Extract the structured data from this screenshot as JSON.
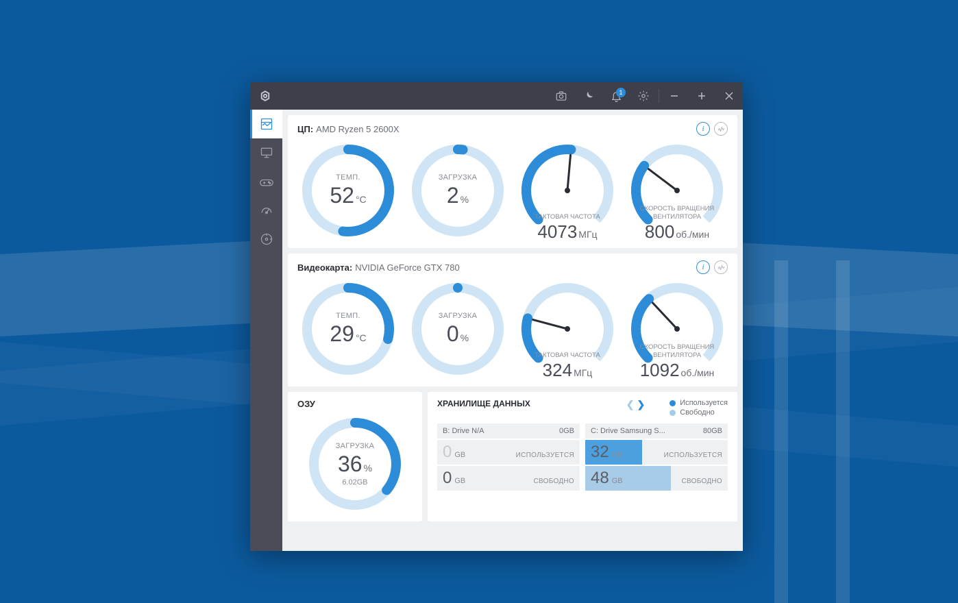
{
  "titlebar": {
    "badge": "1"
  },
  "cpu": {
    "label": "ЦП:",
    "name": "AMD Ryzen 5 2600X",
    "temp": {
      "label": "ТЕМП.",
      "value": "52",
      "unit": "°C",
      "pct": 52
    },
    "load": {
      "label": "ЗАГРУЗКА",
      "value": "2",
      "unit": "%",
      "pct": 2
    },
    "clock": {
      "label": "ТАКТОВАЯ ЧАСТОТА",
      "value": "4073",
      "unit": "МГц",
      "deg": 140
    },
    "fan": {
      "label1": "СКОРОСТЬ ВРАЩЕНИЯ",
      "label2": "ВЕНТИЛЯТОРА",
      "value": "800",
      "unit": "об./мин",
      "deg": 82
    }
  },
  "gpu": {
    "label": "Видеокарта:",
    "name": "NVIDIA GeForce GTX 780",
    "temp": {
      "label": "ТЕМП.",
      "value": "29",
      "unit": "°C",
      "pct": 29
    },
    "load": {
      "label": "ЗАГРУЗКА",
      "value": "0",
      "unit": "%",
      "pct": 0
    },
    "clock": {
      "label": "ТАКТОВАЯ ЧАСТОТА",
      "value": "324",
      "unit": "МГц",
      "deg": 60
    },
    "fan": {
      "label1": "СКОРОСТЬ ВРАЩЕНИЯ",
      "label2": "ВЕНТИЛЯТОРА",
      "value": "1092",
      "unit": "об./мин",
      "deg": 92
    }
  },
  "ram": {
    "title": "ОЗУ",
    "label": "ЗАГРУЗКА",
    "value": "36",
    "unit": "%",
    "pct": 36,
    "sub": "6.02GB"
  },
  "storage": {
    "title": "ХРАНИЛИЩЕ ДАННЫХ",
    "legend": {
      "used": "Используется",
      "free": "Свободно"
    },
    "label_used": "ИСПОЛЬЗУЕТСЯ",
    "label_free": "СВОБОДНО",
    "drives": [
      {
        "name": "B: Drive N/A",
        "size": "0GB",
        "used": "0",
        "used_unit": "GB",
        "used_pct": 0,
        "free": "0",
        "free_unit": "GB",
        "free_pct": 0,
        "dim": true
      },
      {
        "name": "C: Drive Samsung S...",
        "size": "80GB",
        "used": "32",
        "used_unit": "GB",
        "used_pct": 40,
        "free": "48",
        "free_unit": "GB",
        "free_pct": 60
      }
    ]
  }
}
